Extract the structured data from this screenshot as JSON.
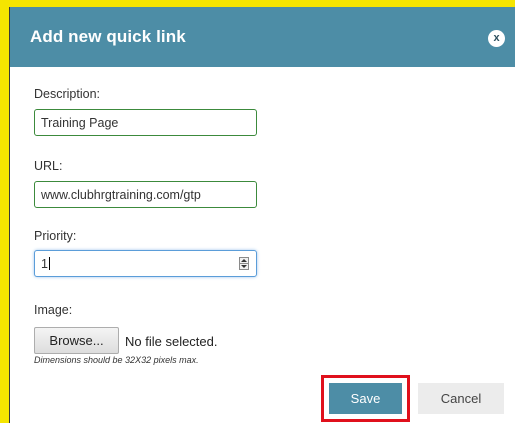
{
  "dialog": {
    "title": "Add new quick link",
    "close_label": "x"
  },
  "form": {
    "description_label": "Description:",
    "description_value": "Training Page",
    "url_label": "URL:",
    "url_value": "www.clubhrgtraining.com/gtp",
    "priority_label": "Priority:",
    "priority_value": "1",
    "image_label": "Image:",
    "browse_label": "Browse...",
    "no_file_text": "No file selected.",
    "dimensions_hint": "Dimensions should be 32X32 pixels max."
  },
  "actions": {
    "save_label": "Save",
    "cancel_label": "Cancel"
  },
  "colors": {
    "titlebar": "#4d8da6",
    "highlight_border": "#e0101c",
    "outer_background": "#f5e500"
  }
}
